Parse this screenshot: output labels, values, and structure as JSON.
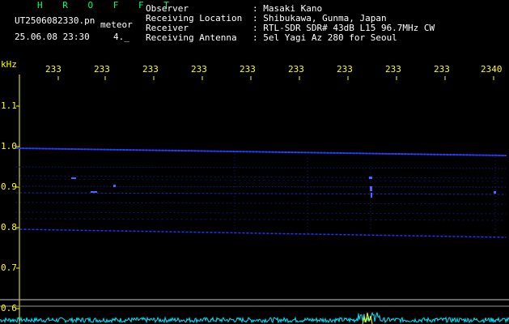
{
  "header": {
    "program": "H R O F F T",
    "filename": "UT2506082330.pn",
    "mode": "meteor",
    "datetime": "25.06.08 23:30",
    "value": "4._",
    "info": [
      {
        "label": "Observer",
        "value": ": Masaki Kano"
      },
      {
        "label": "Receiving Location",
        "value": ": Shibukawa, Gunma, Japan"
      },
      {
        "label": "Receiver",
        "value": ": RTL-SDR SDR# 43dB L15 96.7MHz CW"
      },
      {
        "label": "Receiving Antenna",
        "value": ": 5el Yagi Az 280 for Seoul"
      }
    ]
  },
  "plot": {
    "y_unit": "kHz",
    "y_ticks": [
      "1.1",
      "1.0",
      "0.9",
      "0.8",
      "0.7",
      "0.6"
    ],
    "x_ticks": [
      "233",
      "233",
      "233",
      "233",
      "233",
      "233",
      "233",
      "233",
      "233",
      "2340"
    ],
    "colors": {
      "background": "#000000",
      "trace": "#1a2cff",
      "spectrum": "#00e5ff",
      "peak": "#ffff00",
      "axis_text": "#ffff00",
      "grid": "#ffffff"
    }
  }
}
